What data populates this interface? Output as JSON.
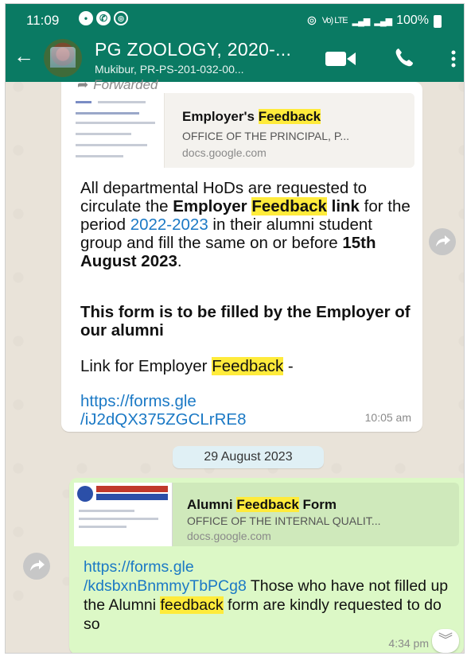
{
  "statusbar": {
    "time": "11:09",
    "network_text": "Vo) LTE",
    "battery": "100%"
  },
  "header": {
    "title": "PG ZOOLOGY, 2020-...",
    "subtitle": "Mukibur, PR-PS-201-032-00..."
  },
  "messages": [
    {
      "forwarded_label": "Forwarded",
      "preview": {
        "title_prefix": "Employer's ",
        "title_highlight": "Feedback",
        "description": "OFFICE OF THE PRINCIPAL, P...",
        "domain": "docs.google.com"
      },
      "body": {
        "p1_a": "All departmental HoDs are requested to circulate the ",
        "p1_b": "Employer ",
        "p1_c": "Feedback",
        "p1_d": " link",
        "p1_e": " for the period ",
        "p1_f": "2022-2023",
        "p1_g": " in their alumni student group and fill the same on or before ",
        "p1_h": "15th  August 2023",
        "p1_i": ".",
        "p2": "This form is to be filled by the Employer of our alumni",
        "p3_a": "Link for Employer ",
        "p3_b": "Feedback",
        "p3_c": " -",
        "link_line1": "https://forms.gle",
        "link_line2": "/iJ2dQX375ZGCLrRE8"
      },
      "time": "10:05 am"
    },
    {
      "date_divider": "29 August 2023",
      "preview": {
        "title_a": "Alumni ",
        "title_highlight": "Feedback",
        "title_b": " Form",
        "description": "OFFICE OF THE INTERNAL QUALIT...",
        "domain": "docs.google.com"
      },
      "body": {
        "link_line1": "https://forms.gle",
        "link_line2": "/kdsbxnBnmmyTbPCg8",
        "text_a": " Those who have not filled up the Alumni ",
        "text_highlight": "feedback",
        "text_b": " form are kindly requested to do so"
      },
      "time": "4:34 pm"
    }
  ],
  "colors": {
    "header_green": "#0a7a63",
    "outgoing_bubble": "#dcf8c6",
    "link_blue": "#1b79c5",
    "highlight": "#ffeb3b"
  }
}
